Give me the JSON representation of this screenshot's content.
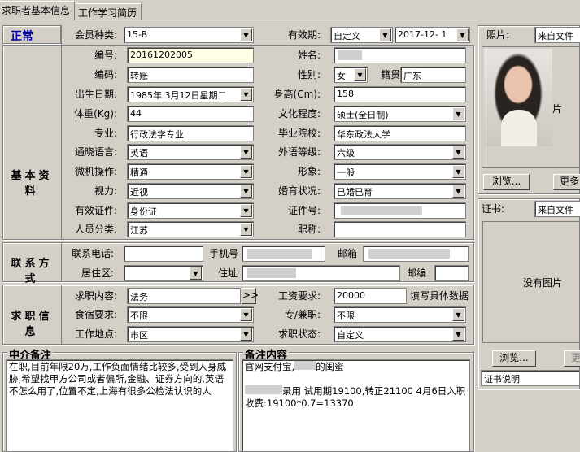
{
  "tabs": [
    "求职者基本信息",
    "工作学习简历"
  ],
  "status": "正常",
  "basic": {
    "section_label": "基本资料",
    "member_type_label": "会员种类:",
    "member_type": "15-B",
    "validity_label": "有效期:",
    "validity_type": "自定义",
    "validity_date": "2017-12- 1",
    "number_label": "编号:",
    "number": "20161202005",
    "name_label": "姓名:",
    "name": "",
    "code_label": "编码:",
    "code": "转账",
    "gender_label": "性别:",
    "gender": "女",
    "origin_label": "籍贯",
    "origin": "广东",
    "birth_label": "出生日期:",
    "birth": "1985年 3月12日星期二",
    "height_label": "身高(Cm):",
    "height": "158",
    "weight_label": "体重(Kg):",
    "weight": "44",
    "education_label": "文化程度:",
    "education": "硕士(全日制)",
    "major_label": "专业:",
    "major": "行政法学专业",
    "school_label": "毕业院校:",
    "school": "华东政法大学",
    "language_label": "通晓语言:",
    "language": "英语",
    "lang_level_label": "外语等级:",
    "lang_level": "六级",
    "computer_label": "微机操作:",
    "computer": "精通",
    "image_label": "形象:",
    "image": "一般",
    "vision_label": "视力:",
    "vision": "近视",
    "marital_label": "婚育状况:",
    "marital": "已婚已育",
    "id_type_label": "有效证件:",
    "id_type": "身份证",
    "id_no_label": "证件号:",
    "category_label": "人员分类:",
    "category": "江苏",
    "title_label": "职称:",
    "title": ""
  },
  "contact": {
    "section_label": "联系方式",
    "phone_label": "联系电话:",
    "mobile_label": "手机号",
    "email_label": "邮箱",
    "region_label": "居住区:",
    "address_label": "住址",
    "postcode_label": "邮编"
  },
  "job": {
    "section_label": "求职信息",
    "content_label": "求职内容:",
    "content": "法务",
    "more_btn": ">>",
    "salary_label": "工资要求:",
    "salary": "20000",
    "salary_hint": "填写具体数据",
    "board_label": "食宿要求:",
    "board": "不限",
    "fulltime_label": "专/兼职:",
    "fulltime": "不限",
    "location_label": "工作地点:",
    "location": "市区",
    "status_label": "求职状态:",
    "status": "自定义"
  },
  "agency_note": {
    "title": "中介备注",
    "text": "在职,目前年限20万,工作负面情绪比较多,受到人身威胁,希望找甲方公司或者偏所,金融、证券方向的,英语不怎么用了,位置不定,上海有很多公检法认识的人"
  },
  "remarks": {
    "title": "备注内容",
    "line1_a": "官网支付宝,",
    "line1_b": "的闺蜜",
    "line2": "录用 试用期19100,转正21100 4月6日入职",
    "line3": "收费:19100*0.7=13370"
  },
  "photo": {
    "label": "照片:",
    "source": "来自文件",
    "browse_btn": "浏览...",
    "more_btn": "更多",
    "side_char": "片"
  },
  "certificate": {
    "label": "证书:",
    "source": "来自文件",
    "no_image": "没有图片",
    "browse_btn": "浏览...",
    "more_btn": "更",
    "desc": "证书说明"
  }
}
